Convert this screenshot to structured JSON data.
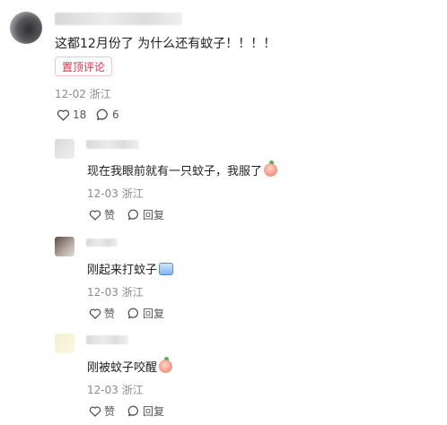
{
  "main_comment": {
    "text": "这都12月份了 为什么还有蚊子！！！！",
    "pinned_label": "置顶评论",
    "date": "12-02",
    "location": "浙江",
    "like_count": "18",
    "reply_count": "6"
  },
  "replies": [
    {
      "text": "现在我眼前就有一只蚊子，我服了",
      "emoji": "peach-emoji",
      "date": "12-03",
      "location": "浙江",
      "like_label": "赞",
      "reply_label": "回复"
    },
    {
      "text": "刚起来打蚊子",
      "emoji": "sticker-emoji",
      "date": "12-03",
      "location": "浙江",
      "like_label": "赞",
      "reply_label": "回复"
    },
    {
      "text": "刚被蚊子咬醒",
      "emoji": "peach-emoji",
      "date": "12-03",
      "location": "浙江",
      "like_label": "赞",
      "reply_label": "回复"
    }
  ],
  "icons": {
    "like": "heart-icon",
    "comment": "comment-bubble-icon"
  },
  "colors": {
    "accent": "#ff2442",
    "meta": "#8a8a8a"
  }
}
